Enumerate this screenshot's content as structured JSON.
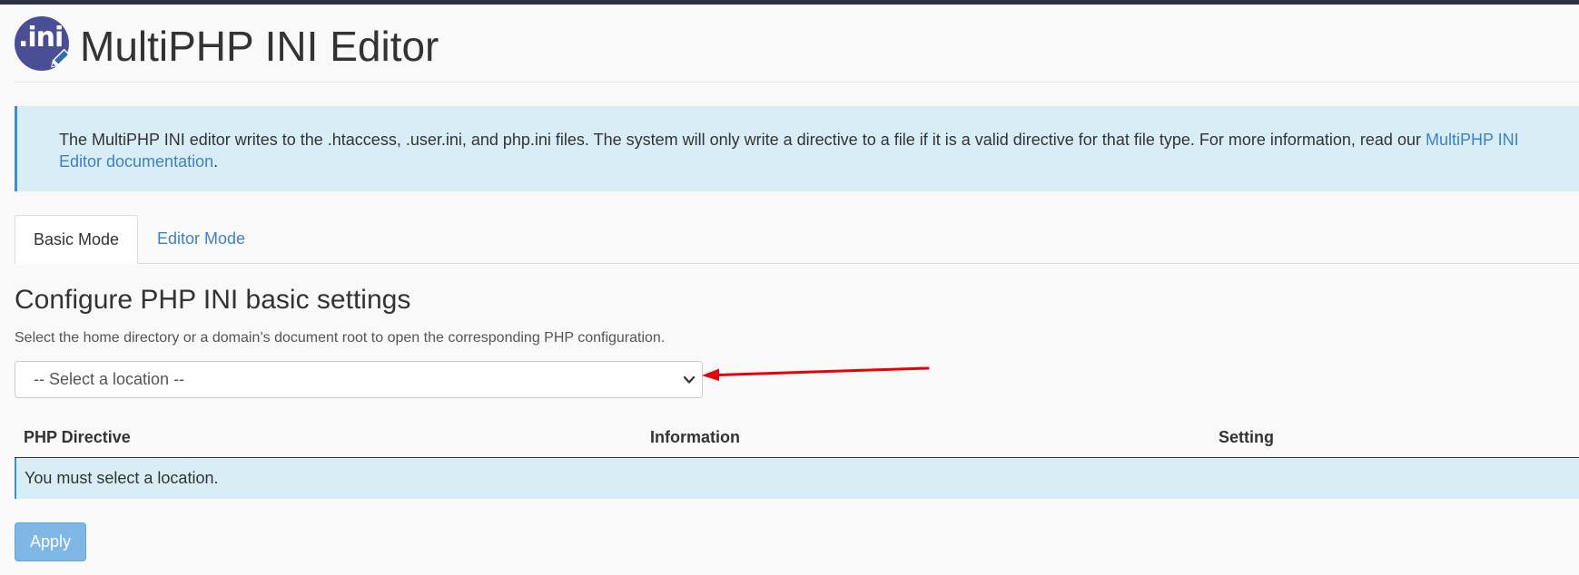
{
  "header": {
    "icon_text": ".ini",
    "title": "MultiPHP INI Editor"
  },
  "info": {
    "text": "The MultiPHP INI editor writes to the .htaccess, .user.ini, and php.ini files. The system will only write a directive to a file if it is a valid directive for that file type. For more information, read our ",
    "link_text": "MultiPHP INI Editor documentation",
    "suffix": "."
  },
  "tabs": [
    {
      "label": "Basic Mode",
      "active": true
    },
    {
      "label": "Editor Mode",
      "active": false
    }
  ],
  "section": {
    "heading": "Configure PHP INI basic settings",
    "description": "Select the home directory or a domain’s document root to open the corresponding PHP configuration."
  },
  "location_select": {
    "selected": "-- Select a location --"
  },
  "table": {
    "columns": [
      "PHP Directive",
      "Information",
      "Setting"
    ],
    "empty_message": "You must select a location."
  },
  "actions": {
    "apply_label": "Apply"
  },
  "colors": {
    "accent": "#3c82c3",
    "info_background": "#d9edf7",
    "icon_background": "#4a4f95",
    "annotation_arrow": "#e8000b",
    "apply_button": "#7eb6e6"
  },
  "icons": {
    "header_icon": "ini-editor-icon",
    "select_chevron": "chevron-down-icon",
    "annotation": "red-arrow-annotation"
  }
}
